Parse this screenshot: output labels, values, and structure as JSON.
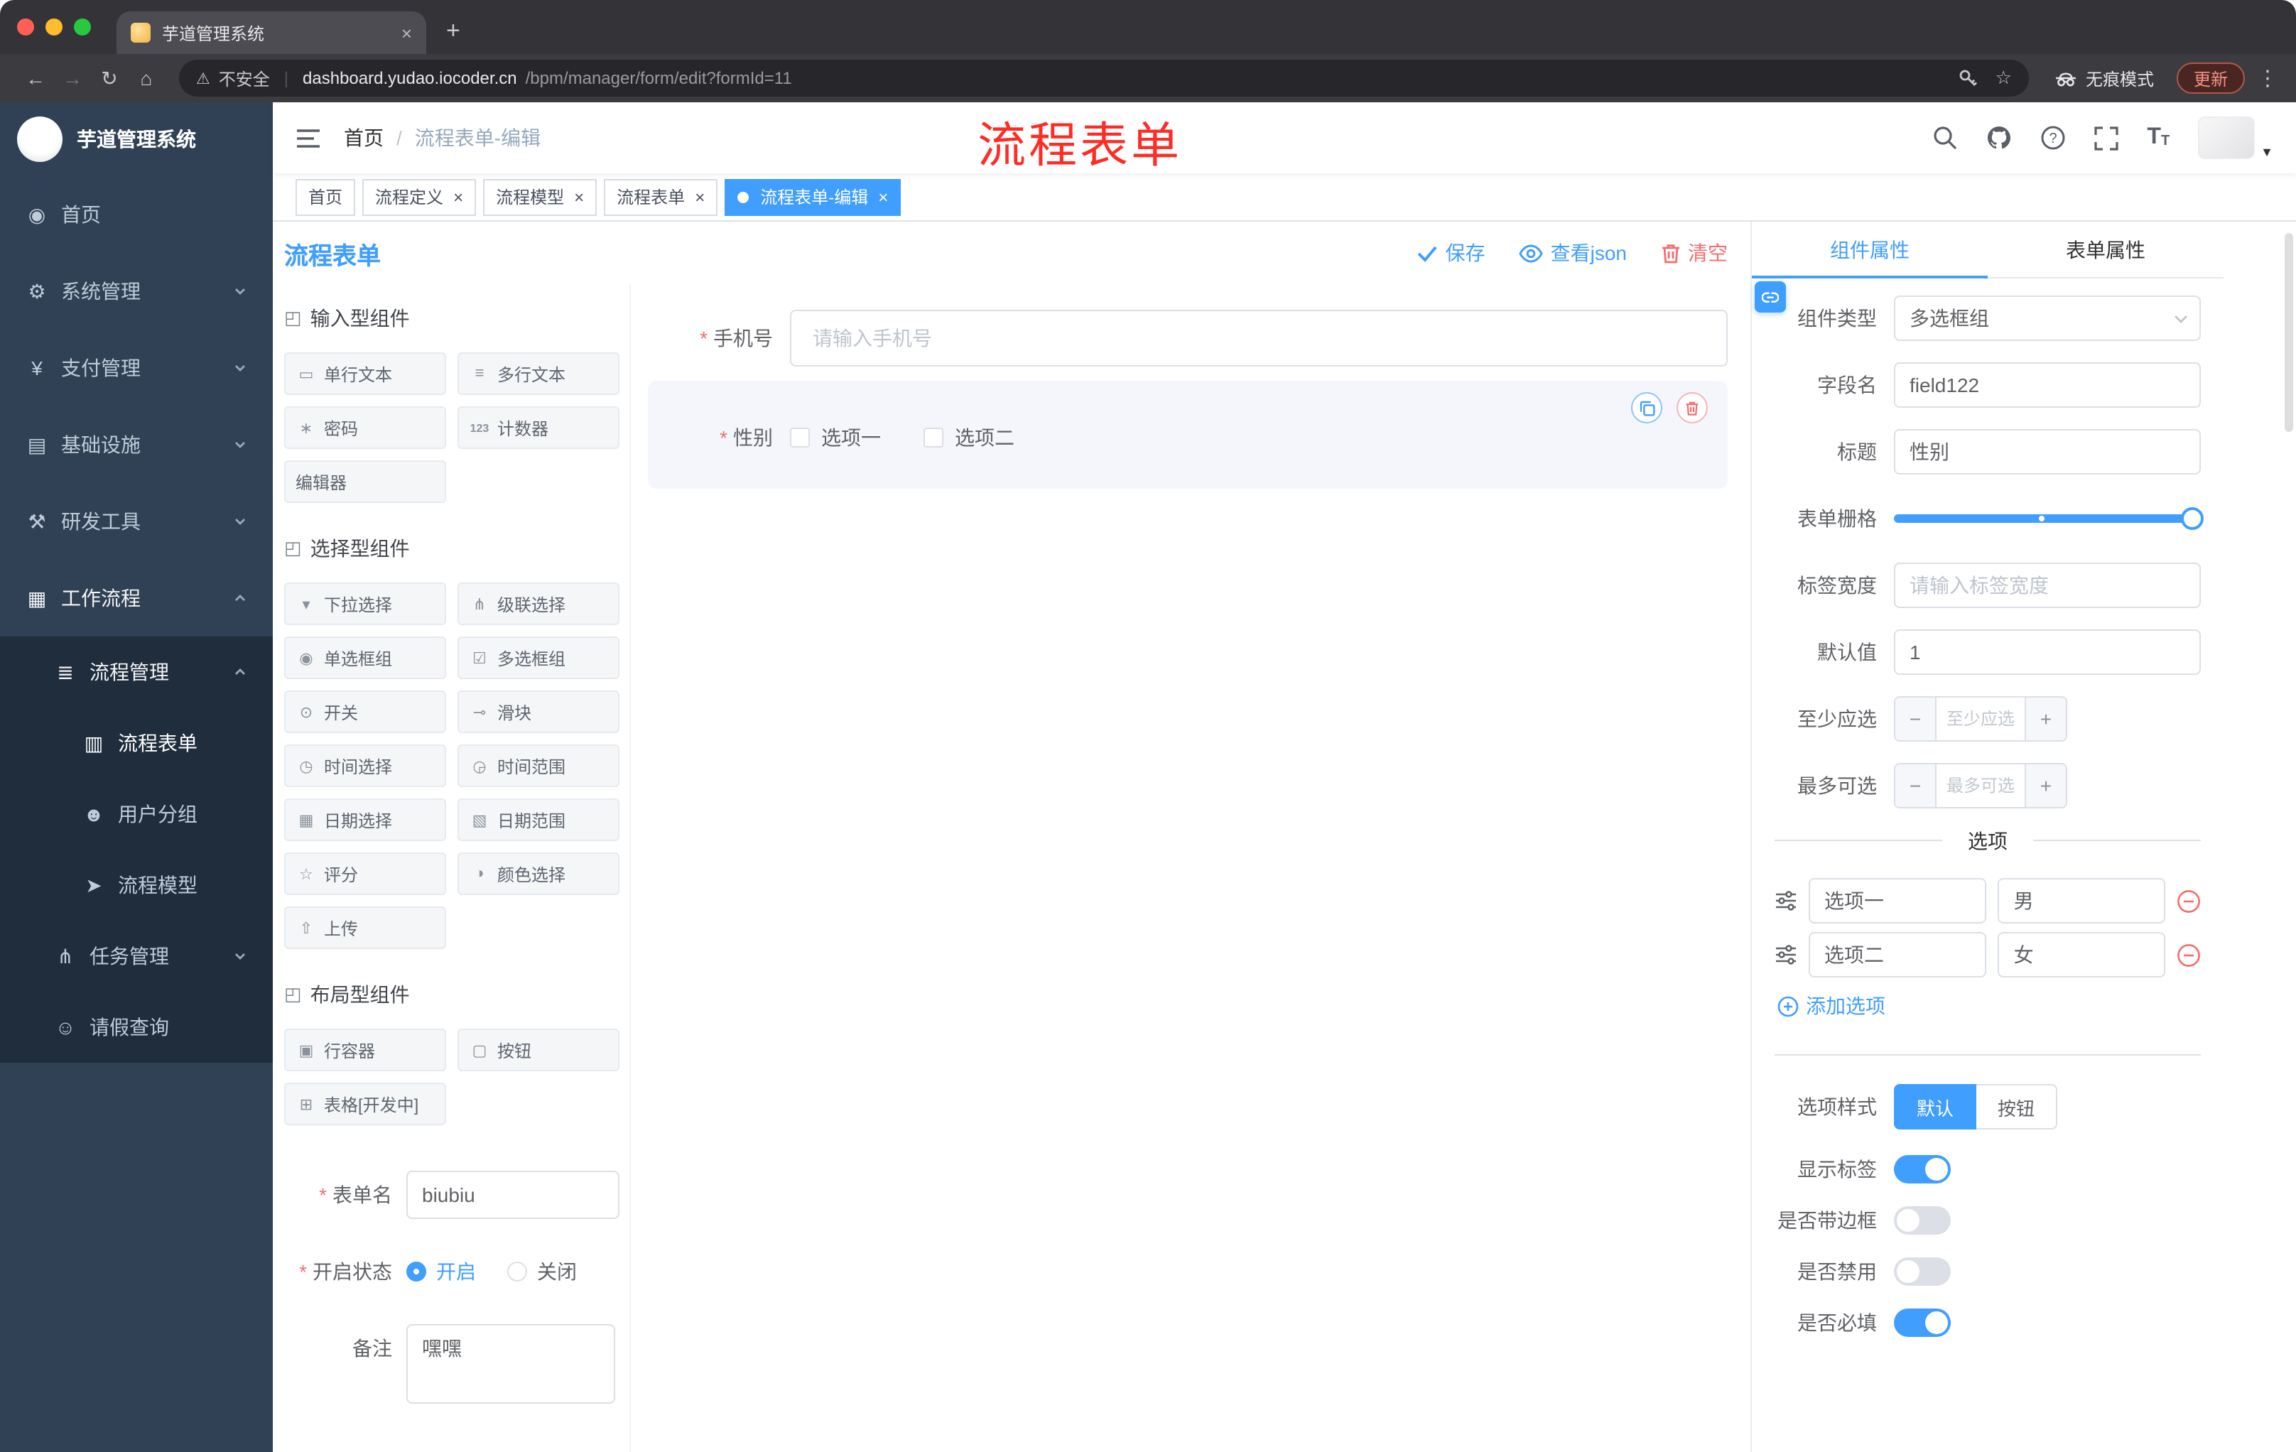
{
  "browser": {
    "tab_title": "芋道管理系统",
    "not_secure_label": "不安全",
    "url_domain": "dashboard.yudao.iocoder.cn",
    "url_path": "/bpm/manager/form/edit?formId=11",
    "incognito_label": "无痕模式",
    "update_label": "更新"
  },
  "sidebar": {
    "logo_title": "芋道管理系统",
    "items": [
      {
        "label": "首页"
      },
      {
        "label": "系统管理"
      },
      {
        "label": "支付管理"
      },
      {
        "label": "基础设施"
      },
      {
        "label": "研发工具"
      },
      {
        "label": "工作流程"
      },
      {
        "label": "流程管理"
      },
      {
        "label": "流程表单"
      },
      {
        "label": "用户分组"
      },
      {
        "label": "流程模型"
      },
      {
        "label": "任务管理"
      },
      {
        "label": "请假查询"
      }
    ]
  },
  "navbar": {
    "breadcrumb_home": "首页",
    "breadcrumb_separator": "/",
    "breadcrumb_current": "流程表单-编辑",
    "annotation": "流程表单"
  },
  "tags": [
    {
      "label": "首页"
    },
    {
      "label": "流程定义"
    },
    {
      "label": "流程模型"
    },
    {
      "label": "流程表单"
    },
    {
      "label": "流程表单-编辑"
    }
  ],
  "designer": {
    "title": "流程表单",
    "save_label": "保存",
    "view_json_label": "查看json",
    "clear_label": "清空",
    "groups": [
      {
        "title": "输入型组件",
        "items": [
          {
            "label": "单行文本",
            "glyph": "▭"
          },
          {
            "label": "多行文本",
            "glyph": "≡"
          },
          {
            "label": "密码",
            "glyph": "∗"
          },
          {
            "label": "计数器",
            "glyph": "123"
          },
          {
            "label": "编辑器",
            "glyph": ""
          }
        ]
      },
      {
        "title": "选择型组件",
        "items": [
          {
            "label": "下拉选择",
            "glyph": "▾"
          },
          {
            "label": "级联选择",
            "glyph": "⋔"
          },
          {
            "label": "单选框组",
            "glyph": "◉"
          },
          {
            "label": "多选框组",
            "glyph": "☑"
          },
          {
            "label": "开关",
            "glyph": "⊙"
          },
          {
            "label": "滑块",
            "glyph": "⊸"
          },
          {
            "label": "时间选择",
            "glyph": "◷"
          },
          {
            "label": "时间范围",
            "glyph": "◶"
          },
          {
            "label": "日期选择",
            "glyph": "▦"
          },
          {
            "label": "日期范围",
            "glyph": "▧"
          },
          {
            "label": "评分",
            "glyph": "☆"
          },
          {
            "label": "颜色选择",
            "glyph": "◑"
          },
          {
            "label": "上传",
            "glyph": "⇧"
          }
        ]
      },
      {
        "title": "布局型组件",
        "items": [
          {
            "label": "行容器",
            "glyph": "▣"
          },
          {
            "label": "按钮",
            "glyph": "▢"
          },
          {
            "label": "表格[开发中]",
            "glyph": "⊞"
          }
        ]
      }
    ],
    "meta": {
      "form_name_label": "表单名",
      "form_name_value": "biubiu",
      "status_label": "开启状态",
      "status_on": "开启",
      "status_off": "关闭",
      "remark_label": "备注",
      "remark_value": "嘿嘿"
    },
    "canvas": {
      "phone_label": "手机号",
      "phone_placeholder": "请输入手机号",
      "gender_label": "性别",
      "gender_option1": "选项一",
      "gender_option2": "选项二"
    }
  },
  "props": {
    "tab_component": "组件属性",
    "tab_form": "表单属性",
    "component_type_label": "组件类型",
    "component_type_value": "多选框组",
    "field_name_label": "字段名",
    "field_name_value": "field122",
    "title_label": "标题",
    "title_value": "性别",
    "grid_label": "表单栅格",
    "label_width_label": "标签宽度",
    "label_width_placeholder": "请输入标签宽度",
    "default_label": "默认值",
    "default_value": "1",
    "min_label": "至少应选",
    "min_placeholder": "至少应选",
    "max_label": "最多可选",
    "max_placeholder": "最多可选",
    "options_title": "选项",
    "option_rows": [
      {
        "label": "选项一",
        "value": "男"
      },
      {
        "label": "选项二",
        "value": "女"
      }
    ],
    "add_option_label": "添加选项",
    "style_label": "选项样式",
    "style_default": "默认",
    "style_button": "按钮",
    "toggle_show_label": "显示标签",
    "toggle_border": "是否带边框",
    "toggle_disabled": "是否禁用",
    "toggle_required": "是否必填"
  },
  "colors": {
    "primary": "#409eff",
    "danger": "#f56c6c",
    "annotation": "#fe2c25",
    "sidebar_bg": "#304156",
    "submenu_bg": "#1f2d3d"
  }
}
